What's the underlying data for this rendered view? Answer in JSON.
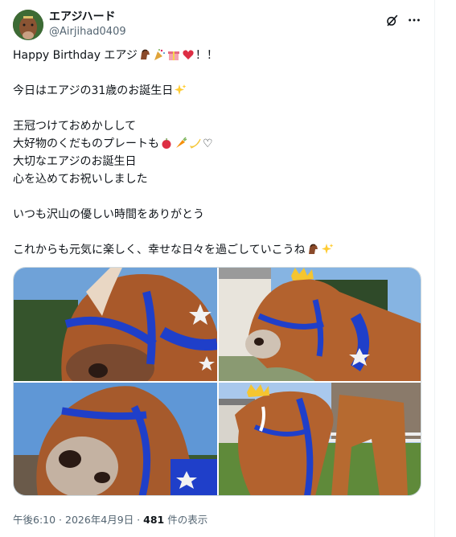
{
  "user": {
    "display_name": "エアジハード",
    "handle": "@Airjihad0409",
    "avatar_icon": "horse-avatar-icon"
  },
  "actions": {
    "grok_icon": "grok-icon",
    "more_icon": "more-icon"
  },
  "tweet": {
    "lines": [
      {
        "text": "Happy Birthday エアジ",
        "suffix": "！！",
        "emojis": [
          "horse",
          "party",
          "gift",
          "heart"
        ]
      },
      {
        "text": "",
        "emojis": []
      },
      {
        "text": "今日はエアジの31歳のお誕生日",
        "suffix": "",
        "emojis": [
          "sparkles"
        ]
      },
      {
        "text": "",
        "emojis": []
      },
      {
        "text": "王冠つけておめかしして",
        "emojis": []
      },
      {
        "text": "大好物のくだものプレートも",
        "suffix": "♡",
        "emojis": [
          "apple",
          "carrot",
          "banana"
        ]
      },
      {
        "text": "大切なエアジのお誕生日",
        "emojis": []
      },
      {
        "text": "心を込めてお祝いしました",
        "emojis": []
      },
      {
        "text": "",
        "emojis": []
      },
      {
        "text": "いつも沢山の優しい時間をありがとう",
        "emojis": []
      },
      {
        "text": "",
        "emojis": []
      },
      {
        "text": "これからも元気に楽しく、幸せな日々を過ごしていこうね",
        "suffix": "",
        "emojis": [
          "horse",
          "sparkles"
        ]
      }
    ]
  },
  "photos": [
    {
      "name": "photo-horse-closeup-blue-halter"
    },
    {
      "name": "photo-horse-with-crown"
    },
    {
      "name": "photo-horse-nose-closeup"
    },
    {
      "name": "photo-horse-grazing"
    }
  ],
  "meta": {
    "time": "午後6:10 · 2026年4月9日 · ",
    "views_count": "481",
    "views_label": " 件の表示"
  },
  "colors": {
    "text": "#0f1419",
    "secondary": "#536471",
    "halter_blue": "#1f3fc9",
    "horse_chestnut": "#b5652f"
  }
}
